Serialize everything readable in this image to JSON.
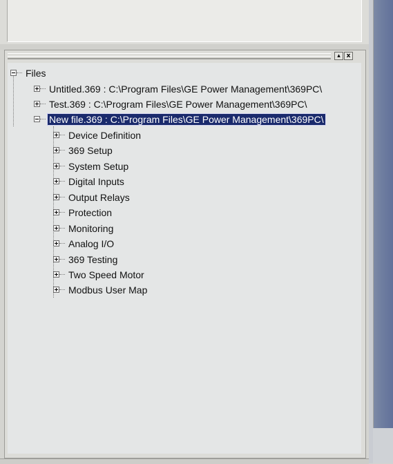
{
  "panel": {
    "restore_symbol": "▴",
    "close_symbol": "x"
  },
  "tree": {
    "root": {
      "label": "Files",
      "expanded": true
    },
    "files": [
      {
        "label": "Untitled.369 : C:\\Program Files\\GE Power Management\\369PC\\",
        "expanded": false,
        "selected": false
      },
      {
        "label": "Test.369 : C:\\Program Files\\GE Power Management\\369PC\\",
        "expanded": false,
        "selected": false
      },
      {
        "label": "New file.369 : C:\\Program Files\\GE Power Management\\369PC\\",
        "expanded": true,
        "selected": true
      }
    ],
    "children": [
      {
        "label": "Device Definition"
      },
      {
        "label": "369 Setup"
      },
      {
        "label": "System Setup"
      },
      {
        "label": "Digital Inputs"
      },
      {
        "label": "Output Relays"
      },
      {
        "label": "Protection"
      },
      {
        "label": "Monitoring"
      },
      {
        "label": "Analog I/O"
      },
      {
        "label": "369 Testing"
      },
      {
        "label": "Two Speed Motor"
      },
      {
        "label": "Modbus User Map"
      }
    ]
  },
  "colors": {
    "selection_bg": "#1a2a6c",
    "tree_bg": "#e4e6e6",
    "side_strip": "#6f7ea0"
  }
}
